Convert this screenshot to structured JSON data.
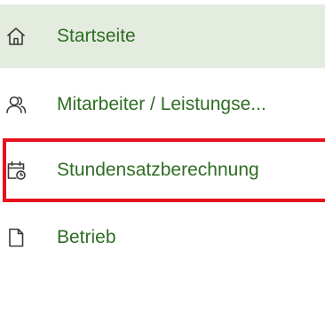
{
  "nav": {
    "items": [
      {
        "label": "Startseite",
        "icon": "home-icon",
        "active": true
      },
      {
        "label": "Mitarbeiter / Leistungse...",
        "icon": "users-icon",
        "active": false
      },
      {
        "label": "Stundensatzberechnung",
        "icon": "calendar-clock-icon",
        "active": false
      },
      {
        "label": "Betrieb",
        "icon": "document-icon",
        "active": false
      }
    ]
  },
  "colors": {
    "active_bg": "#e4ecdf",
    "label": "#2f6d24",
    "icon": "#3a3a3a",
    "highlight": "#e8101c"
  }
}
